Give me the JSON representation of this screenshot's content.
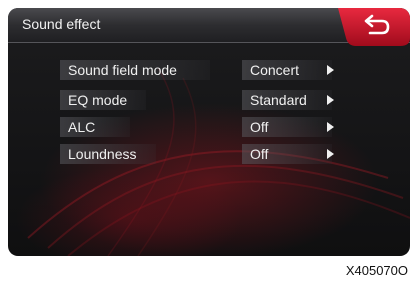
{
  "header": {
    "title": "Sound effect",
    "back_icon": "return-arrow-icon"
  },
  "menu": {
    "items": [
      {
        "label": "Sound field mode",
        "value": "Concert"
      },
      {
        "label": "EQ mode",
        "value": "Standard"
      },
      {
        "label": "ALC",
        "value": "Off"
      },
      {
        "label": "Loundness",
        "value": "Off"
      }
    ]
  },
  "caption": "X405070O",
  "colors": {
    "accent_red": "#c8102e",
    "background": "#141416",
    "text": "#f0f0f0"
  }
}
